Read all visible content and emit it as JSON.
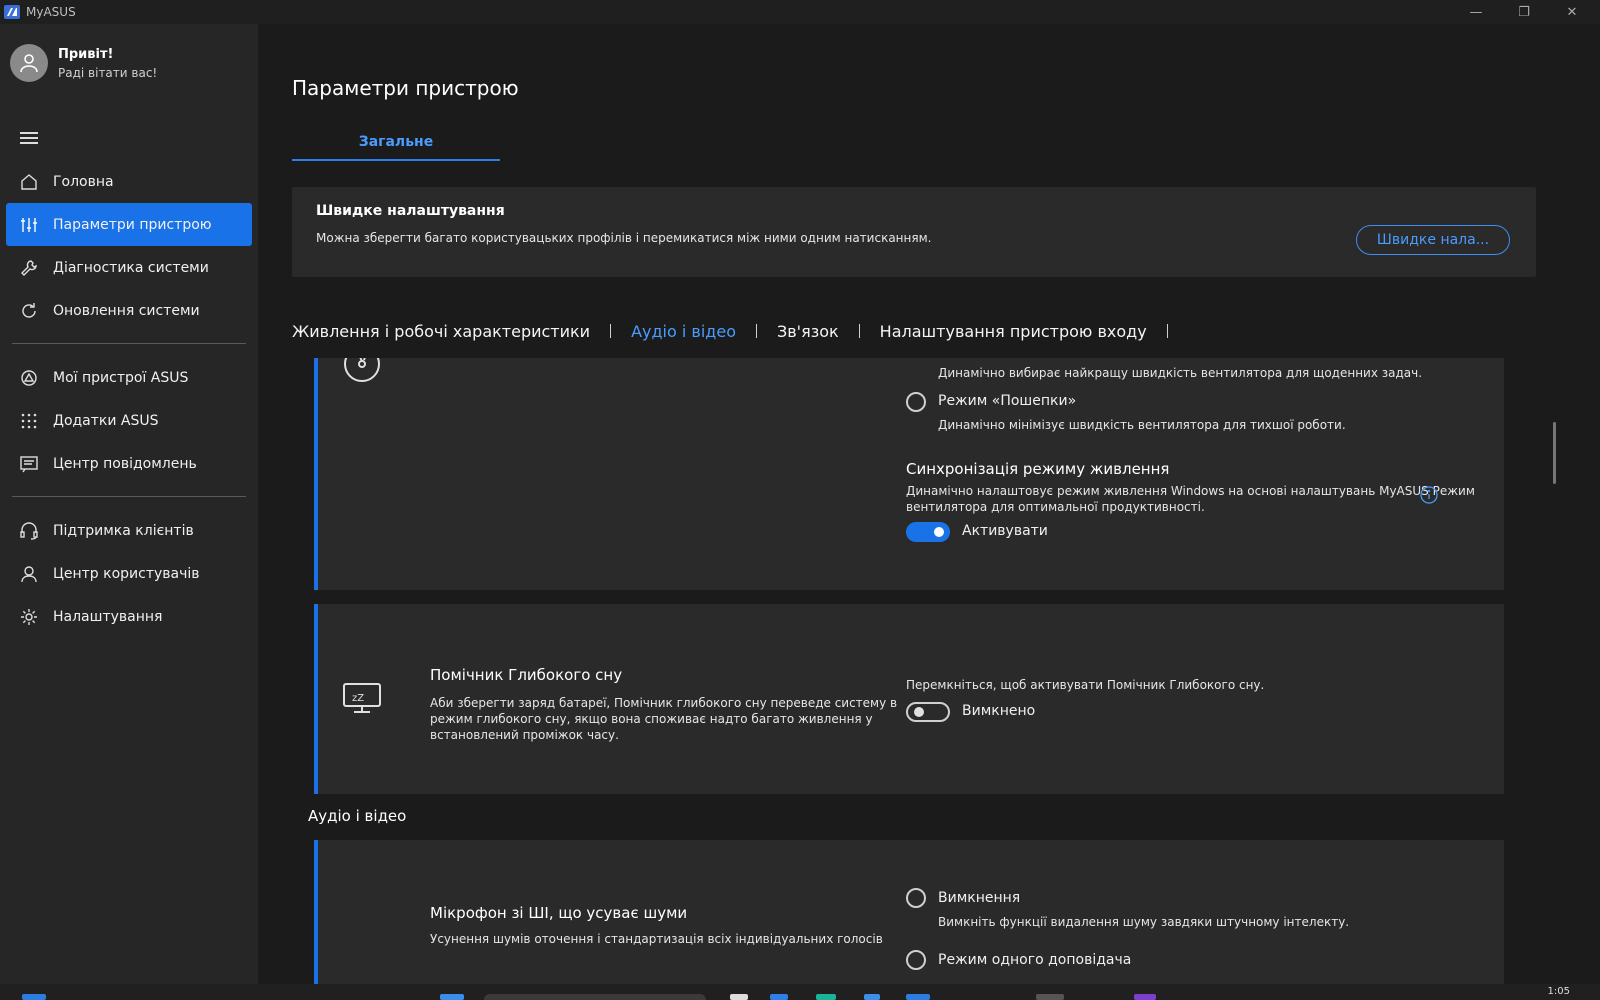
{
  "window": {
    "title": "MyASUS",
    "minimize": "—",
    "maximize": "❐",
    "close": "✕"
  },
  "sidebar": {
    "greeting": "Привіт!",
    "greeting_sub": "Раді вітати вас!",
    "items": [
      {
        "label": "Головна",
        "icon": "home-icon"
      },
      {
        "label": "Параметри пристрою",
        "icon": "sliders-icon",
        "active": true
      },
      {
        "label": "Діагностика системи",
        "icon": "wrench-icon"
      },
      {
        "label": "Оновлення системи",
        "icon": "update-icon"
      },
      {
        "label": "Мої пристрої ASUS",
        "icon": "asus-devices-icon"
      },
      {
        "label": "Додатки ASUS",
        "icon": "apps-grid-icon"
      },
      {
        "label": "Центр повідомлень",
        "icon": "message-icon"
      },
      {
        "label": "Підтримка клієнтів",
        "icon": "headset-icon"
      },
      {
        "label": "Центр користувачів",
        "icon": "user-icon"
      },
      {
        "label": "Налаштування",
        "icon": "gear-icon"
      }
    ]
  },
  "main": {
    "title": "Параметри пристрою",
    "tab": "Загальне",
    "quick": {
      "title": "Швидке налаштування",
      "desc": "Можна зберегти багато користувацьких профілів і перемикатися між ними одним натисканням.",
      "button": "Швидке нала..."
    },
    "categories": [
      "Живлення і робочі характеристики",
      "Аудіо і відео",
      "Зв'язок",
      "Налаштування пристрою входу"
    ],
    "active_category": "Аудіо і відео",
    "fan_card": {
      "option1_desc": "Динамічно вибирає найкращу швидкість вентилятора для щоденних задач.",
      "option2_label": "Режим «Пошепки»",
      "option2_desc": "Динамічно мінімізує швидкість вентилятора для тихшої роботи.",
      "sync_title": "Синхронізація режиму живлення",
      "sync_desc_line1": "Динамічно налаштовує режим живлення Windows на основі налаштувань MyASUS Режим",
      "sync_desc_line2": "вентилятора для оптимальної продуктивності.",
      "toggle_label": "Активувати",
      "toggle_on": true
    },
    "sleep_card": {
      "title": "Помічник Глибокого сну",
      "desc_line1": "Аби зберегти заряд батареї, Помічник глибокого сну переведе систему в",
      "desc_line2": "режим глибокого сну, якщо вона споживає надто багато живлення у",
      "desc_line3": "встановлений проміжок часу.",
      "hint": "Перемкніться, щоб активувати Помічник Глибокого сну.",
      "toggle_label": "Вимкнено",
      "toggle_on": false
    },
    "audio_section": "Аудіо і відео",
    "mic_card": {
      "title": "Мікрофон зі ШІ, що усуває шуми",
      "desc": "Усунення шумів оточення і стандартизація всіх індивідуальних голосів",
      "option1_label": "Вимкнення",
      "option1_desc": "Вимкніть функції видалення шуму завдяки штучному інтелекту.",
      "option2_label": "Режим одного доповідача"
    }
  },
  "taskbar": {
    "clock": "1:05"
  },
  "colors": {
    "accent": "#1a72e8",
    "link": "#4a9cff",
    "sidebar_bg": "#262626",
    "card_bg": "#2a2a2a"
  }
}
